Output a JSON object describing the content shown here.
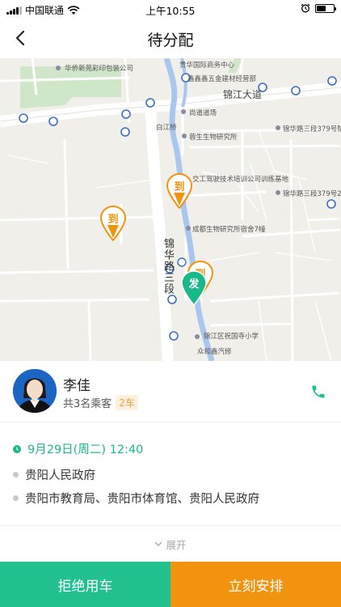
{
  "status_bar": {
    "carrier": "中国联通",
    "time": "上午10:55",
    "battery_level": 0.55
  },
  "nav": {
    "title": "待分配",
    "back_icon": "back-arrow-icon"
  },
  "map": {
    "labels": {
      "printing_co": "华侨新苑彩印包装公司",
      "intl_center": "贵华国际商务中心",
      "building_materials": "鑫鑫鑫五金建材经营部",
      "jinjiang_avenue": "锦江大道",
      "shangdao_daochang": "尚道道场",
      "jinhua_379_a": "锦华路三段379号院",
      "baijiang_qiao": "白江桥",
      "rongsheng_bio": "蓉生生物研究所",
      "traffic_training": "交工驾驶技术培训公司训练基地",
      "jinhua_379_b": "锦华路三段379号22",
      "chengdu_bio_dorm": "成都生物研究所宿舍7幢",
      "jinhua_road_3": "锦华路三段",
      "xianghu_school": "锦江区祝国寺小学",
      "zhonghe_auto": "众和鑫汽修"
    },
    "pins": {
      "arrive_label": "到",
      "depart_label": "发"
    },
    "colors": {
      "arrive_pin": "#f1930f",
      "depart_pin": "#1ab78b"
    }
  },
  "passenger": {
    "name": "李佳",
    "summary": "共3名乘客",
    "cars": "2车",
    "phone_icon": "phone-icon"
  },
  "trip": {
    "datetime": "9月29日(周二)  12:40",
    "origin": "贵阳人民政府",
    "destinations": "贵阳市教育局、贵阳市体育馆、贵阳人民政府"
  },
  "expand_label": "展开",
  "actions": {
    "reject": "拒绝用车",
    "arrange": "立刻安排"
  },
  "colors": {
    "accent_green": "#22c08f",
    "accent_orange": "#f1930f"
  }
}
